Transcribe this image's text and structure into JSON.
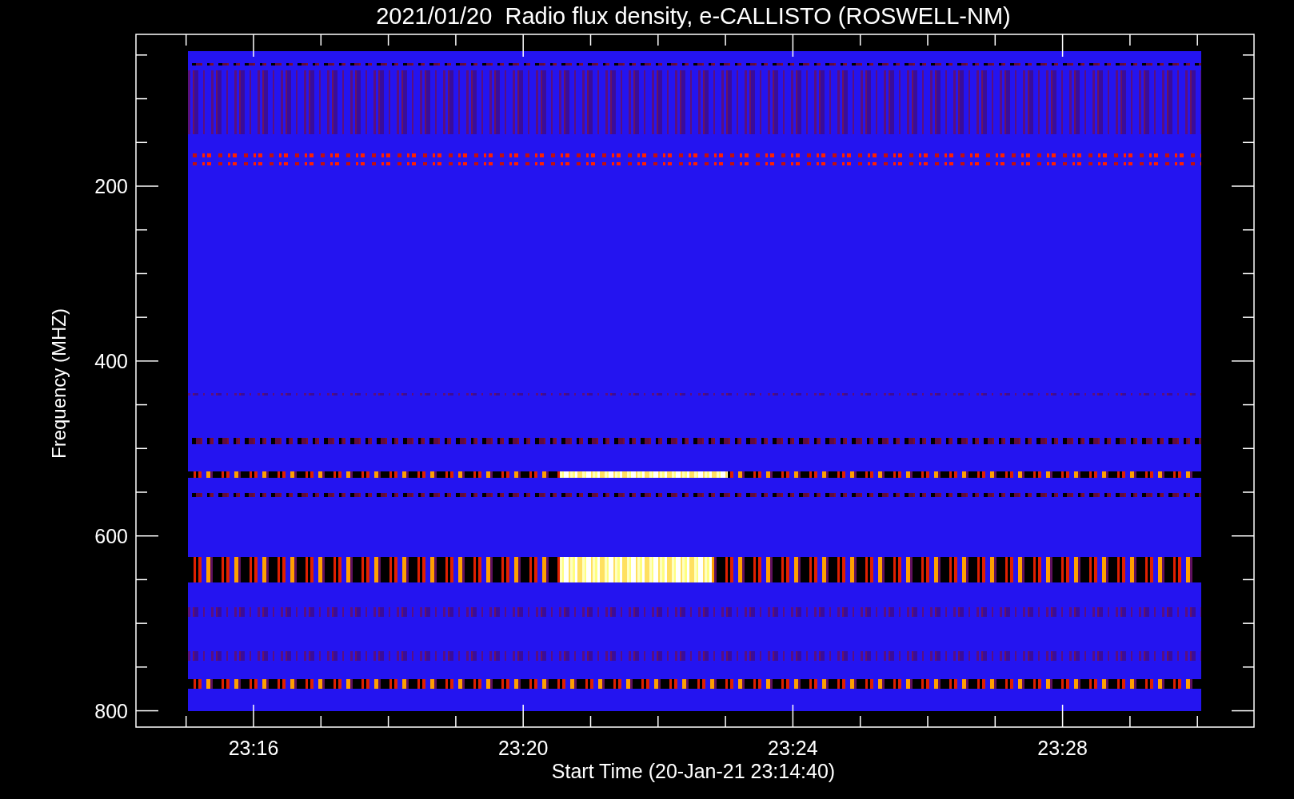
{
  "title": "2021/01/20  Radio flux density, e-CALLISTO (ROSWELL-NM)",
  "y_axis": {
    "label": "Frequency (MHZ)",
    "ticks": [
      "200",
      "400",
      "600",
      "800"
    ]
  },
  "x_axis": {
    "label": "Start Time (20-Jan-21 23:14:40)",
    "ticks": [
      "23:16",
      "23:20",
      "23:24",
      "23:28"
    ]
  }
}
